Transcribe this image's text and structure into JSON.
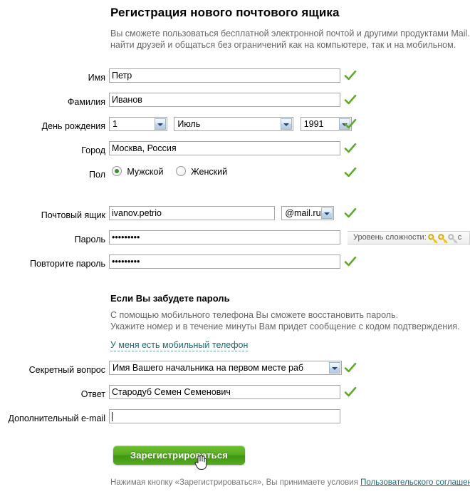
{
  "header": {
    "title": "Регистрация нового почтового ящика",
    "intro_line1": "Вы сможете пользоваться бесплатной электронной почтой и другими продуктами Mail.R",
    "intro_line2": "найти друзей и общаться без ограничений как на компьютере, так и на мобильном."
  },
  "fields": {
    "first_name": {
      "label": "Имя",
      "value": "Петр",
      "valid": true
    },
    "last_name": {
      "label": "Фамилия",
      "value": "Иванов",
      "valid": true
    },
    "birthday": {
      "label": "День рождения",
      "day": "1",
      "month": "Июль",
      "year": "1991",
      "valid": true
    },
    "city": {
      "label": "Город",
      "value": "Москва, Россия",
      "valid": true
    },
    "gender": {
      "label": "Пол",
      "options": [
        "Мужской",
        "Женский"
      ],
      "selected": "Мужской",
      "valid": true
    },
    "mailbox": {
      "label": "Почтовый ящик",
      "value": "ivanov.petrio",
      "domain": "@mail.ru",
      "valid": true
    },
    "password": {
      "label": "Пароль",
      "value": "•••••••••",
      "strength_label": "Уровень сложности:",
      "strength_suffix": "с",
      "keys_filled": 2,
      "keys_total": 3
    },
    "password_repeat": {
      "label": "Повторите пароль",
      "value": "•••••••••",
      "valid": true
    },
    "secret_question": {
      "label": "Секретный вопрос",
      "value": "Имя Вашего начальника на первом месте раб",
      "valid": true
    },
    "answer": {
      "label": "Ответ",
      "value": "Стародуб Семен Семенович",
      "valid": true
    },
    "extra_email": {
      "label": "Дополнительный e-mail",
      "value": "",
      "placeholder": ""
    }
  },
  "forgot": {
    "heading": "Если Вы забудете пароль",
    "line1": "С помощью мобильного телефона Вы сможете восстановить пароль.",
    "line2": "Укажите номер и в течение минуты Вам придет сообщение с кодом подтверждения.",
    "link": "У меня есть мобильный телефон"
  },
  "submit": {
    "label": "Зарегистрироваться"
  },
  "footnote": {
    "text_before": "Нажимая кнопку «Зарегистрироваться», Вы принимаете условия ",
    "link": "Пользовательского соглашения",
    "text_after": "."
  },
  "colors": {
    "check_green": "#5FA82A",
    "button_green": "#58ae20",
    "link_teal": "#1c6a72",
    "key_gold": "#e8c020",
    "key_gray": "#b9b9b9"
  }
}
